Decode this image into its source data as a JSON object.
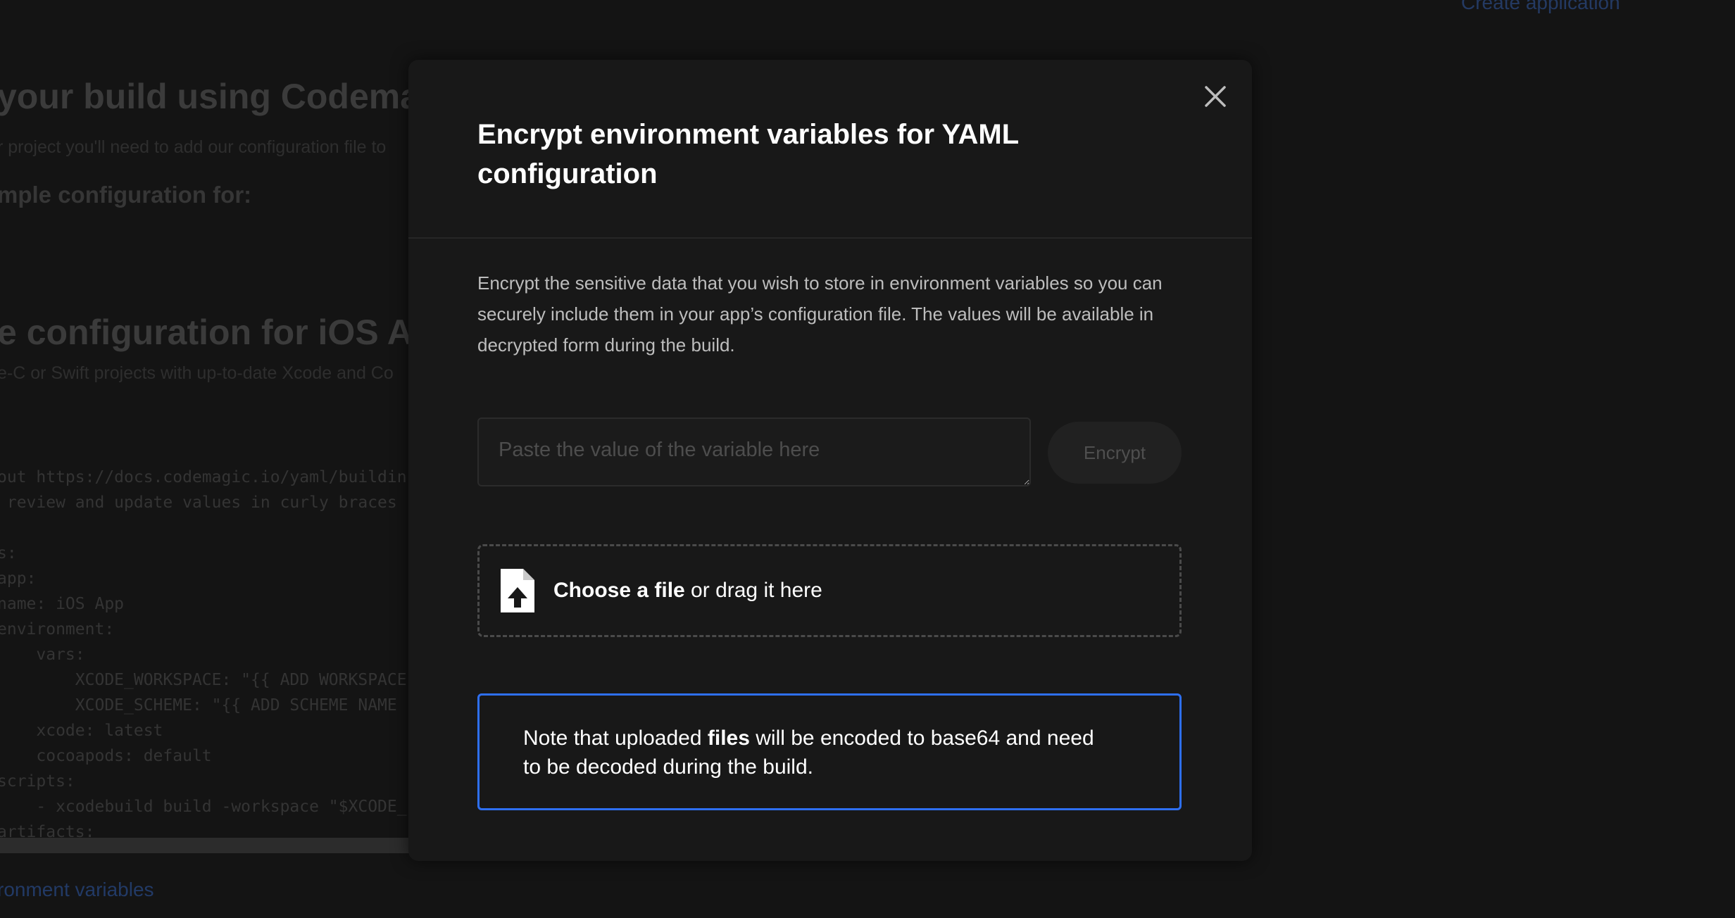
{
  "background": {
    "top_link": "Create application",
    "heading": "your build using Codemagic",
    "intro_text": "r project you'll need to add our configuration file to",
    "subheading": "mple configuration for:",
    "section_heading": "e configuration for iOS App",
    "section_text": "e-C or Swift projects with up-to-date Xcode and Co",
    "code_lines": [
      "out https://docs.codemagic.io/yaml/buildin",
      " review and update values in curly braces",
      "",
      "s:",
      "app:",
      "name: iOS App",
      "environment:",
      "    vars:",
      "        XCODE_WORKSPACE: \"{{ ADD WORKSPACE",
      "        XCODE_SCHEME: \"{{ ADD SCHEME NAME",
      "    xcode: latest",
      "    cocoapods: default",
      "scripts:",
      "    - xcodebuild build -workspace \"$XCODE_",
      "artifacts:"
    ],
    "bottom_link": "ronment variables"
  },
  "modal": {
    "title": "Encrypt environment variables for YAML configuration",
    "close_icon": "close-icon",
    "description": "Encrypt the sensitive data that you wish to store in environment variables so you can securely include them in your app’s configuration file. The values will be available in decrypted form during the build.",
    "input": {
      "placeholder": "Paste the value of the variable here",
      "value": ""
    },
    "encrypt_label": "Encrypt",
    "dropzone": {
      "icon": "file-upload-icon",
      "choose_label": "Choose a file",
      "drag_label": " or drag it here"
    },
    "note": {
      "prefix": "Note that uploaded ",
      "bold": "files",
      "suffix": " will be encoded to base64 and need to be decoded during the build."
    }
  },
  "colors": {
    "overlay_bg": "#141414",
    "modal_bg": "#181818",
    "note_border": "#2e6ff2",
    "text_primary": "#ffffff",
    "text_secondary": "#bdbdbd"
  }
}
